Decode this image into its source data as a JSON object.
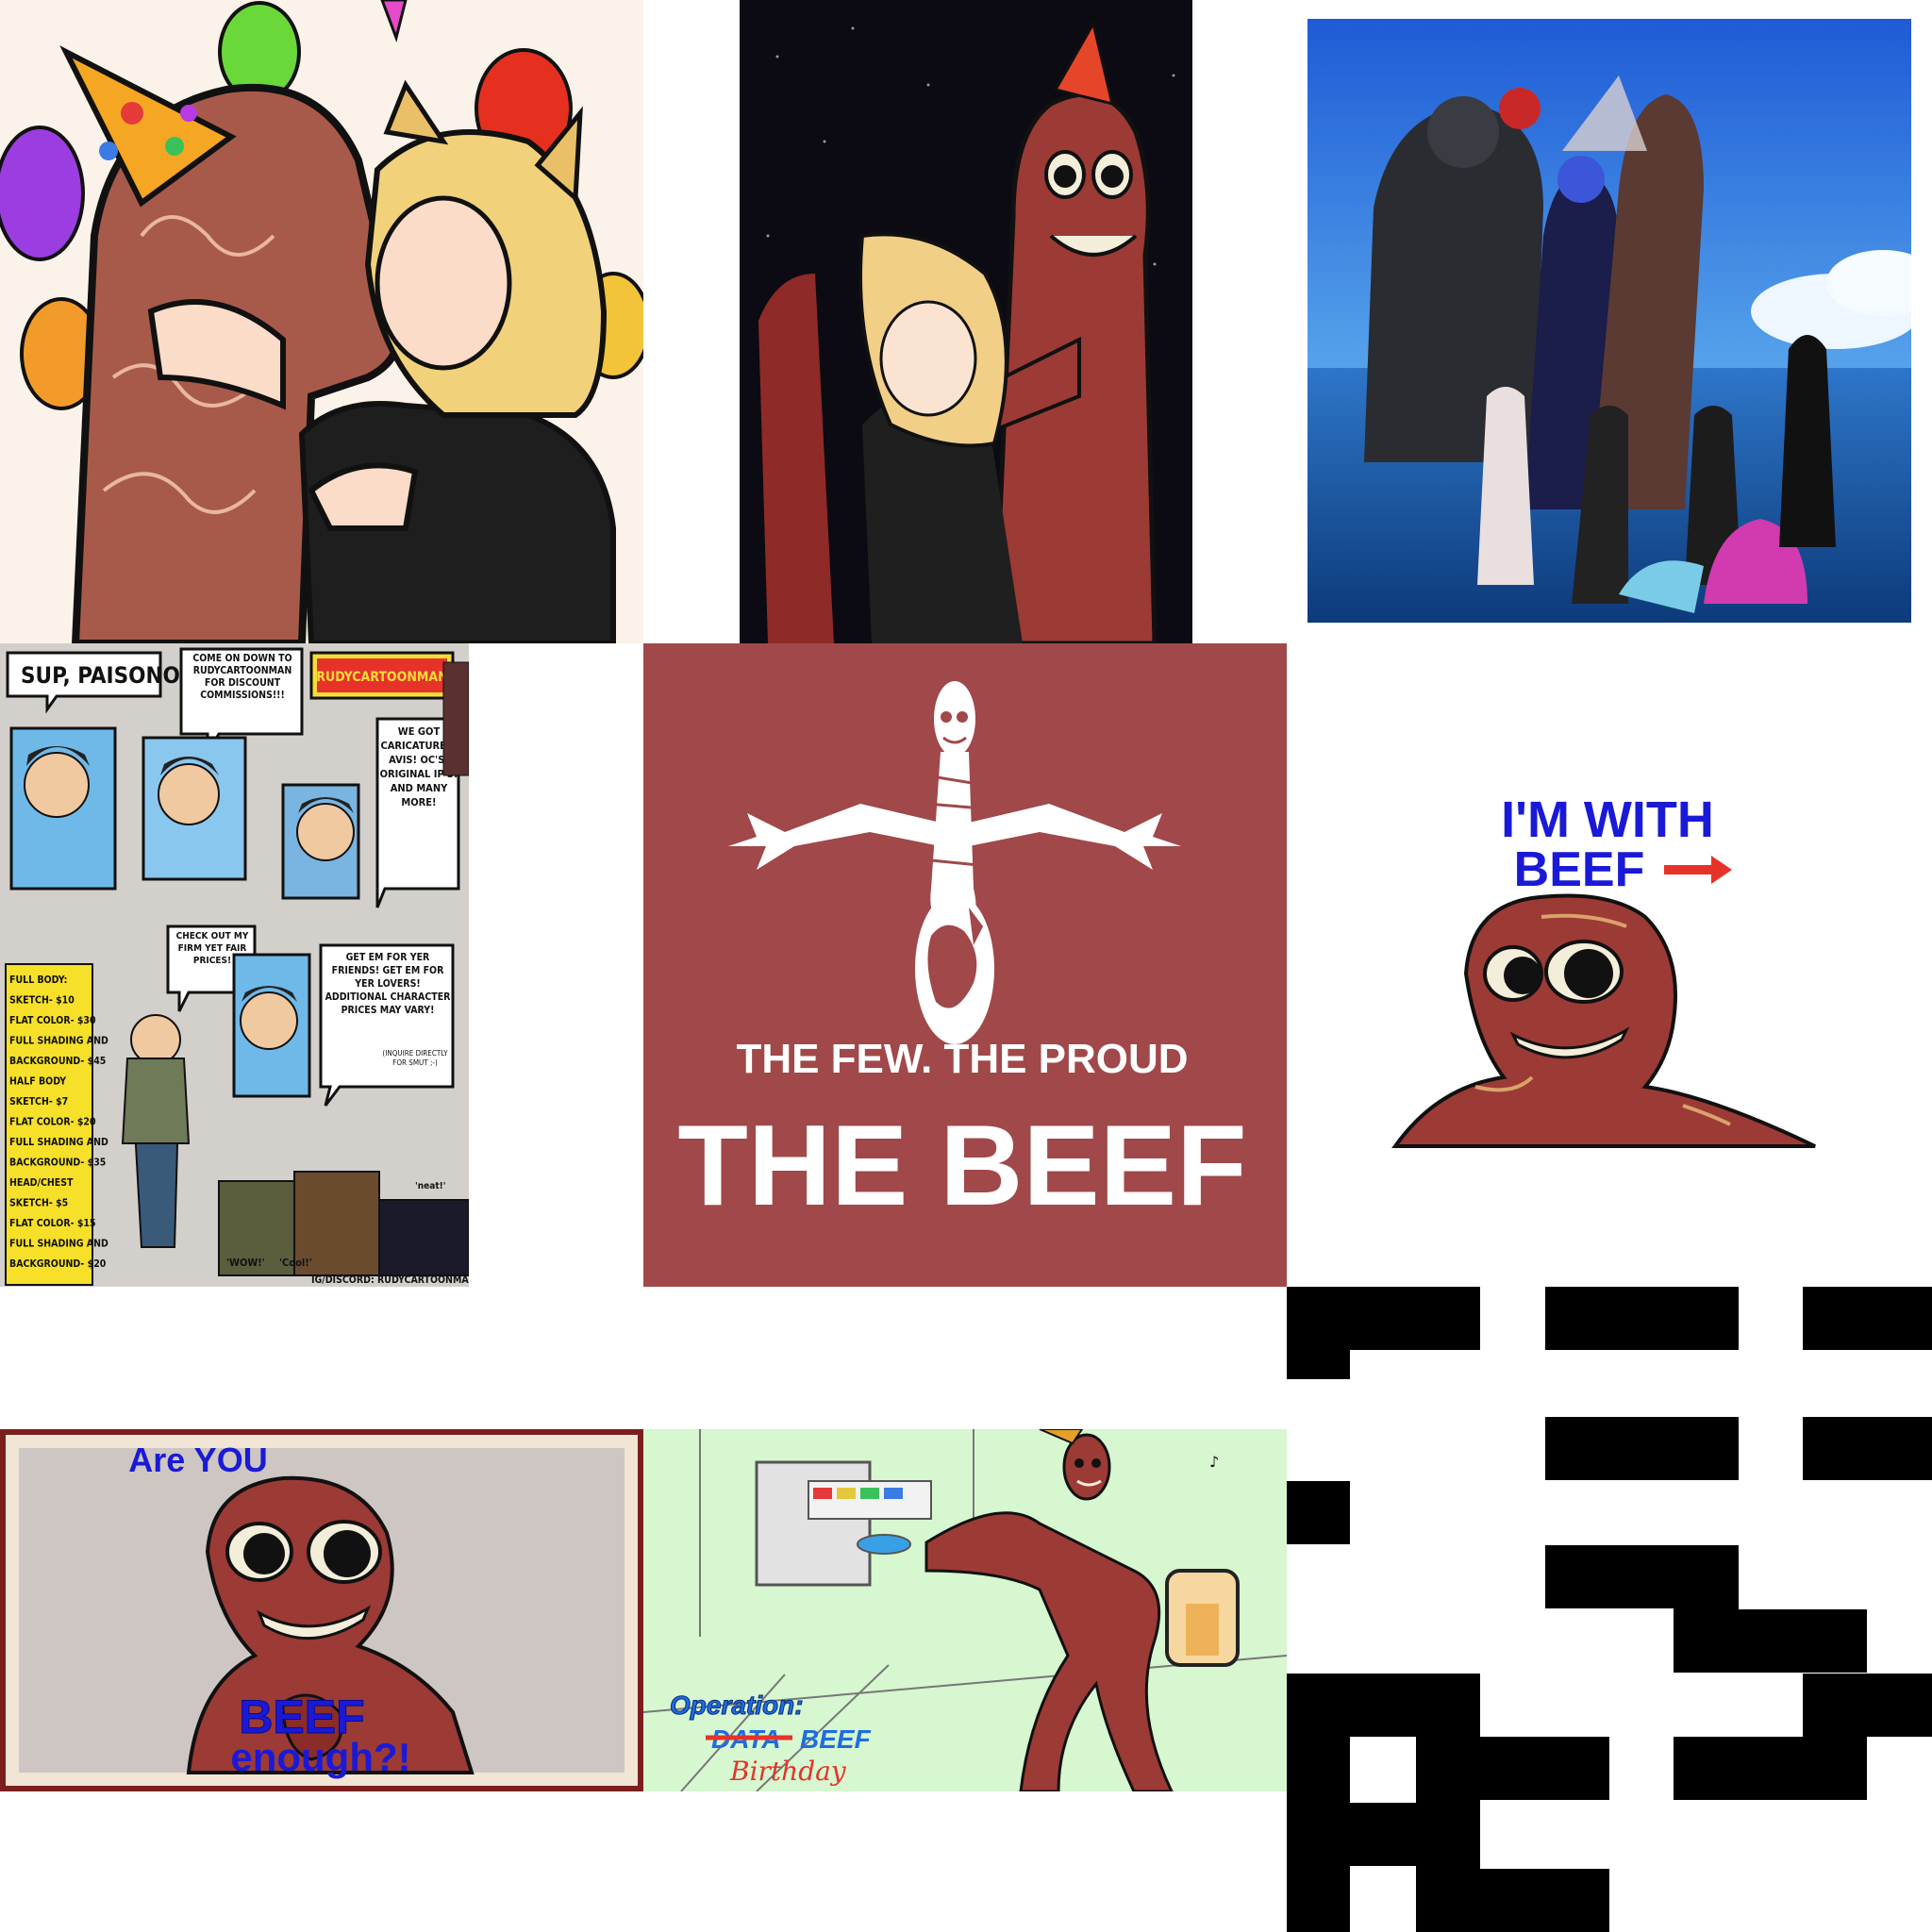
{
  "collage": {
    "tile_sup": {
      "bubble_1": "SUP, PAISONOS!",
      "bubble_2": "COME ON DOWN TO RUDYCARTOONMAN FOR DISCOUNT COMMISSIONS!!!",
      "logo": "RUDYCARTOONMAN",
      "bubble_3": "WE GOT CARICATURES! AVIS! OC'S! ORIGINAL IP'S! AND MANY MORE!",
      "bubble_4": "CHECK OUT MY FIRM YET FAIR PRICES!",
      "bubble_5": "GET EM FOR YER FRIENDS! GET EM FOR YER LOVERS! ADDITIONAL CHARACTER PRICES MAY VARY!",
      "bubble_6": "(INQUIRE DIRECTLY FOR SMUT ;-)",
      "prices": [
        "FULL BODY:",
        "SKETCH- $10",
        "FLAT COLOR- $30",
        "FULL SHADING AND",
        "BACKGROUND- $45",
        "HALF BODY",
        "SKETCH- $7",
        "FLAT COLOR- $20",
        "FULL SHADING AND",
        "BACKGROUND- $35",
        "HEAD/CHEST",
        "SKETCH- $5",
        "FLAT COLOR- $15",
        "FULL SHADING AND",
        "BACKGROUND- $20"
      ],
      "caption_wow": "'WOW!'",
      "caption_cool": "'Cool!'",
      "caption_neat": "'neat!'",
      "contact": "IG/DISCORD: RUDYCARTOONMAN"
    },
    "tile_few": {
      "tagline": "THE FEW. THE PROUD",
      "headline": "THE BEEF"
    },
    "tile_with": {
      "line_1": "I'M WITH",
      "line_2": "BEEF"
    },
    "tile_are_you": {
      "top": "Are YOU",
      "middle": "BEEF",
      "bottom": "enough?!"
    },
    "tile_operation": {
      "title": "Operation:",
      "struck": "DATA",
      "word": "BEEF",
      "handwritten": "Birthday"
    }
  },
  "colors": {
    "beef_red": "#a0484a",
    "creature_body": "#9c3a36",
    "sky_blue": "#3d86d6",
    "poster_blue": "#1a1ad6",
    "operation_blue": "#1e6de0",
    "mint": "#d6f7cf"
  }
}
